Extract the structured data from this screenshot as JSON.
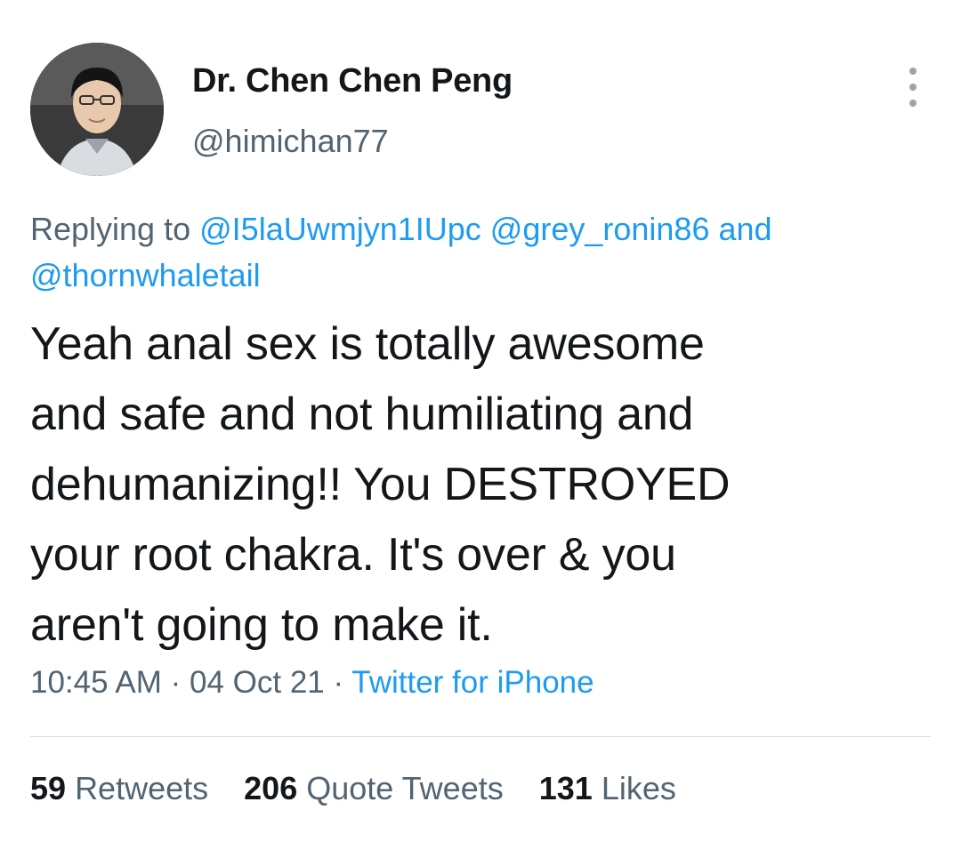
{
  "author": {
    "display_name": "Dr. Chen Chen Peng",
    "handle": "@himichan77"
  },
  "reply_context": {
    "prefix": "Replying to",
    "mentions": [
      "@I5laUwmjyn1IUpc",
      "@grey_ronin86",
      "@thornwhaletail"
    ],
    "joiner": "and"
  },
  "tweet": {
    "text_lines": [
      "Yeah anal sex is totally awesome",
      "and safe and not humiliating and",
      "dehumanizing!! You DESTROYED",
      "your root chakra. It's over & you",
      "aren't going to make it."
    ]
  },
  "meta": {
    "time": "10:45 AM",
    "separator": "·",
    "date": "04 Oct 21",
    "source": "Twitter for iPhone"
  },
  "stats": {
    "retweets": {
      "count": "59",
      "label": "Retweets"
    },
    "quote_tweets": {
      "count": "206",
      "label": "Quote Tweets"
    },
    "likes": {
      "count": "131",
      "label": "Likes"
    }
  },
  "icons": {
    "more": "more-vertical-icon",
    "avatar": "profile-avatar"
  },
  "colors": {
    "link": "#1d9bf0",
    "secondary_text": "#536471",
    "primary_text": "#14171a"
  }
}
